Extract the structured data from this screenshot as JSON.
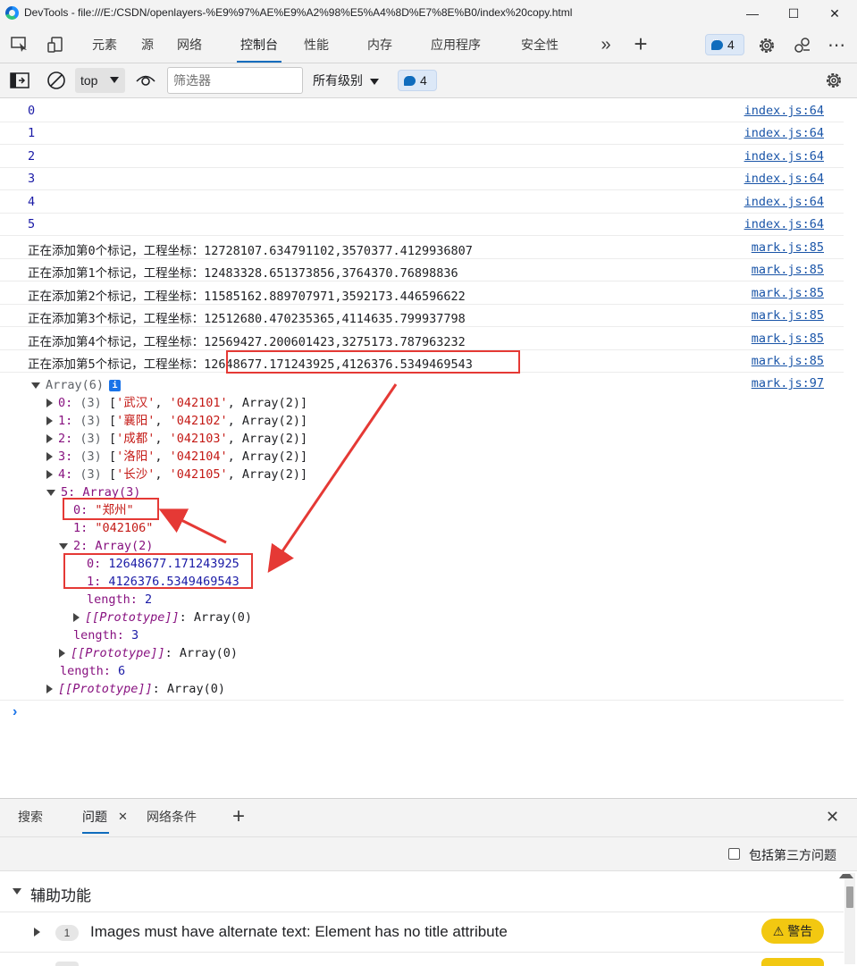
{
  "window": {
    "title": "DevTools - file:///E:/CSDN/openlayers-%E9%97%AE%E9%A2%98%E5%A4%8D%E7%8E%B0/index%20copy.html",
    "minimize_glyph": "—",
    "maximize_glyph": "☐",
    "close_glyph": "✕"
  },
  "main_tabs": [
    {
      "label": "元素"
    },
    {
      "label": "源"
    },
    {
      "label": "网络"
    },
    {
      "label": "控制台",
      "active": true
    },
    {
      "label": "性能"
    },
    {
      "label": "内存"
    },
    {
      "label": "应用程序"
    },
    {
      "label": "安全性"
    }
  ],
  "toolbar": {
    "more_tabs": "»",
    "add_tab": "+",
    "issues_count": "4",
    "more_menu": "⋯"
  },
  "console_toolbar": {
    "context": "top",
    "filter_placeholder": "筛选器",
    "levels": "所有级别",
    "issues_count": "4"
  },
  "messages": [
    {
      "text": "0",
      "source": "index.js:64"
    },
    {
      "text": "1",
      "source": "index.js:64"
    },
    {
      "text": "2",
      "source": "index.js:64"
    },
    {
      "text": "3",
      "source": "index.js:64"
    },
    {
      "text": "4",
      "source": "index.js:64"
    },
    {
      "text": "5",
      "source": "index.js:64"
    },
    {
      "text": "正在添加第0个标记，工程坐标：12728107.634791102,3570377.4129936807",
      "source": "mark.js:85"
    },
    {
      "text": "正在添加第1个标记，工程坐标：12483328.651373856,3764370.76898836",
      "source": "mark.js:85"
    },
    {
      "text": "正在添加第2个标记，工程坐标：11585162.889707971,3592173.446596622",
      "source": "mark.js:85"
    },
    {
      "text": "正在添加第3个标记，工程坐标：12512680.470235365,4114635.799937798",
      "source": "mark.js:85"
    },
    {
      "text": "正在添加第4个标记，工程坐标：12569427.200601423,3275173.787963232",
      "source": "mark.js:85"
    },
    {
      "prefix": "正在添加第5个标记，工程坐标：",
      "coords": "12648677.171243925,4126376.5349469543",
      "source": "mark.js:85"
    }
  ],
  "array_log": {
    "header": "Array(6)",
    "source": "mark.js:97",
    "entries": [
      {
        "index": "0",
        "count": "(3)",
        "city": "'武汉'",
        "code": "'042101'",
        "rest": "Array(2)"
      },
      {
        "index": "1",
        "count": "(3)",
        "city": "'襄阳'",
        "code": "'042102'",
        "rest": "Array(2)"
      },
      {
        "index": "2",
        "count": "(3)",
        "city": "'成都'",
        "code": "'042103'",
        "rest": "Array(2)"
      },
      {
        "index": "3",
        "count": "(3)",
        "city": "'洛阳'",
        "code": "'042104'",
        "rest": "Array(2)"
      },
      {
        "index": "4",
        "count": "(3)",
        "city": "'长沙'",
        "code": "'042105'",
        "rest": "Array(2)"
      }
    ],
    "expanded": {
      "label": "5: Array(3)",
      "item0_key": "0:",
      "item0_value": "\"郑州\"",
      "item1_key": "1:",
      "item1_value": "\"042106\"",
      "item2_label": "2: Array(2)",
      "sub0_key": "0:",
      "sub0_value": "12648677.171243925",
      "sub1_key": "1:",
      "sub1_value": "4126376.5349469543",
      "sub_length_key": "length:",
      "sub_length_value": "2",
      "sub_proto_key": "[[Prototype]]",
      "sub_proto_value": ": Array(0)",
      "length_key": "length:",
      "length_value": "3",
      "proto_key": "[[Prototype]]",
      "proto_value": ": Array(0)"
    },
    "length_key": "length:",
    "length_value": "6",
    "proto_key": "[[Prototype]]",
    "proto_value": ": Array(0)"
  },
  "prompt": "›",
  "drawer": {
    "tabs": [
      {
        "label": "搜索"
      },
      {
        "label": "问题",
        "active": true
      },
      {
        "label": "网络条件"
      }
    ],
    "tab_close": "✕",
    "add": "+",
    "close": "✕",
    "third_party_label": "包括第三方问题",
    "section_title": "辅助功能",
    "issues": [
      {
        "count": "1",
        "text": "Images must have alternate text: Element has no title attribute",
        "badge": "⚠ 警告"
      }
    ]
  }
}
